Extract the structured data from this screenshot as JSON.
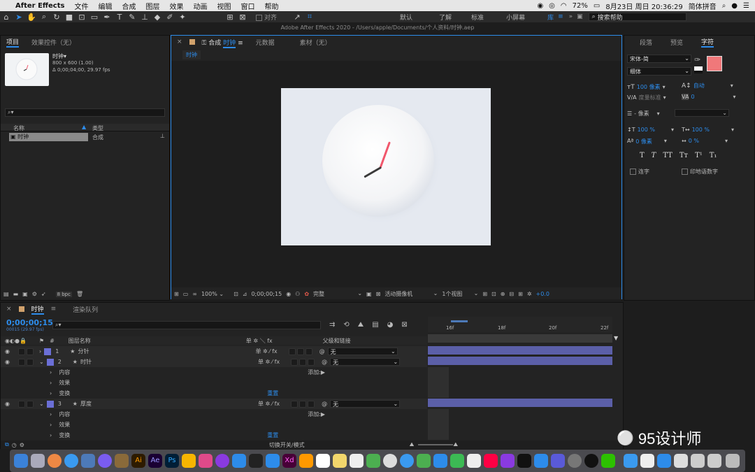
{
  "menubar": {
    "app_name": "After Effects",
    "items": [
      "文件",
      "编辑",
      "合成",
      "图层",
      "效果",
      "动画",
      "视图",
      "窗口",
      "帮助"
    ],
    "battery": "72%",
    "datetime": "8月23日 周日  20:36:29",
    "input_method": "简体拼音"
  },
  "window_title": "Adobe After Effects 2020 - /Users/apple/Documents/个人资料/时钟.aep",
  "toolbar": {
    "snap_label": "对齐",
    "workspaces": [
      "默认",
      "了解",
      "标准",
      "小屏幕",
      "库"
    ],
    "active_workspace": "库",
    "help_placeholder": "搜索帮助"
  },
  "project_panel": {
    "tabs": [
      "项目",
      "效果控件（无）"
    ],
    "item_name": "时钟▾",
    "item_size": "800 x 600 (1.00)",
    "item_duration": "Δ 0;00;04;00, 29.97 fps",
    "col_name": "名称",
    "col_type": "类型",
    "row_name": "时钟",
    "row_type": "合成",
    "bpc": "8 bpc"
  },
  "comp_panel": {
    "tabs": [
      "合成 时钟",
      "元数据",
      "素材（无）"
    ],
    "comp_tab_prefix": "合成",
    "comp_tab_name": "时钟",
    "crumb": "时钟",
    "zoom": "100%",
    "timecode": "0;00;00;15",
    "quality": "完整",
    "camera": "活动摄像机",
    "views": "1个视图",
    "exposure": "+0.0",
    "clock": {
      "hour_angle": 240,
      "minute_angle": 20,
      "hour_color": "#3a3a3a",
      "minute_color": "#f1576c"
    }
  },
  "char_panel": {
    "tabs": [
      "段落",
      "预览",
      "字符"
    ],
    "active_tab": "字符",
    "font": "宋体-简",
    "style": "细体",
    "font_size": "100 像素",
    "leading": "自动",
    "kerning": "度量标准",
    "tracking": "0",
    "stroke_width": "- 像素",
    "vscale": "100 %",
    "hscale": "100 %",
    "baseline": "0 像素",
    "tsume": "0 %",
    "fill_color": "#f0787a",
    "opt1": "连字",
    "opt2": "印地语数字",
    "styles": [
      "T",
      "T",
      "TT",
      "Tт",
      "T¹",
      "T₁"
    ]
  },
  "timeline": {
    "tabs": [
      "时钟",
      "渲染队列"
    ],
    "timecode": "0;00;00;15",
    "frame_info": "00015 (29.97 fps)",
    "col_hash": "#",
    "col_layer": "图层名称",
    "col_switches": "单 ✲ ＼ fx",
    "col_parent": "父级和链接",
    "ruler": [
      "16f",
      "18f",
      "20f",
      "22f"
    ],
    "layers": [
      {
        "num": "1",
        "name": "分针",
        "parent": "无",
        "color": "#6b6fd6"
      },
      {
        "num": "2",
        "name": "时针",
        "parent": "无",
        "color": "#6b6fd6"
      },
      {
        "num": "3",
        "name": "厚度",
        "parent": "无",
        "color": "#6b6fd6"
      }
    ],
    "sub": {
      "content": "内容",
      "effects": "效果",
      "transform": "变换",
      "add": "添加:",
      "reset": "重置"
    },
    "toggle_label": "切换开关/模式"
  },
  "watermark": "95设计师"
}
